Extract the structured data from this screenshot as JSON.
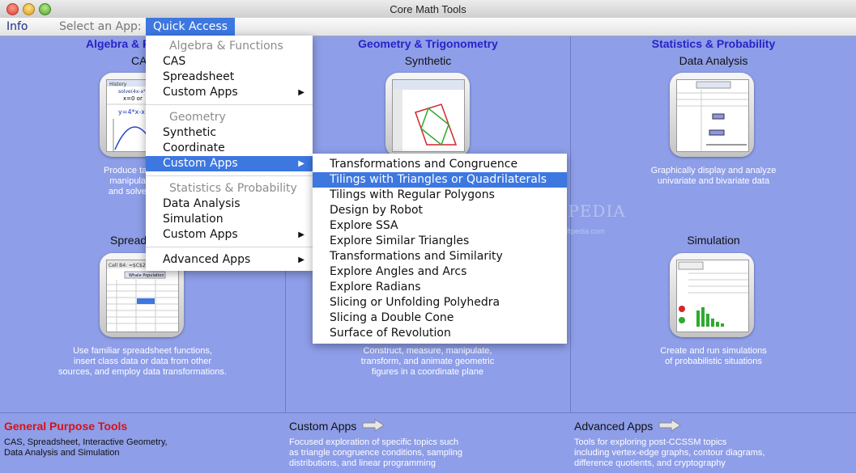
{
  "window": {
    "title": "Core Math Tools"
  },
  "menubar": {
    "info": "Info",
    "select_app": "Select an App:",
    "quick_access": "Quick Access"
  },
  "panels": {
    "algebra": {
      "category": "Algebra & F",
      "app1": "CAS",
      "desc1": [
        "Produce tables and g",
        "manipulate symbo",
        "and solve equation"
      ],
      "app2": "Spread",
      "desc2": [
        "Use familiar spreadsheet functions,",
        "insert class data or data from other",
        "sources, and employ data transformations."
      ]
    },
    "geometry": {
      "category": "Geometry & Trigonometry",
      "app1": "Synthetic",
      "desc2": [
        "Construct, measure, manipulate,",
        "transform, and animate geometric",
        "figures in a coordinate plane"
      ]
    },
    "statistics": {
      "category": "Statistics & Probability",
      "app1": "Data Analysis",
      "desc1": [
        "Graphically display and analyze",
        "univariate and bivariate data"
      ],
      "app2": "Simulation",
      "desc2": [
        "Create and run simulations",
        "of probabilistic situations"
      ]
    }
  },
  "bottom": {
    "general": {
      "title": "General Purpose Tools",
      "lines": [
        "CAS, Spreadsheet, Interactive Geometry,",
        "Data Analysis and Simulation"
      ]
    },
    "custom": {
      "title": "Custom Apps",
      "lines": [
        "Focused exploration of specific topics such",
        "as triangle congruence conditions, sampling",
        "distributions, and linear programming"
      ]
    },
    "advanced": {
      "title": "Advanced Apps",
      "lines": [
        "Tools for exploring post-CCSSM topics",
        "including vertex-edge graphs, contour diagrams,",
        "difference quotients, and cryptography"
      ]
    }
  },
  "quick_menu": {
    "h_algebra": "Algebra & Functions",
    "cas": "CAS",
    "spreadsheet": "Spreadsheet",
    "custom1": "Custom Apps",
    "h_geometry": "Geometry",
    "synthetic": "Synthetic",
    "coordinate": "Coordinate",
    "custom2": "Custom Apps",
    "h_stats": "Statistics & Probability",
    "data_analysis": "Data Analysis",
    "simulation": "Simulation",
    "custom3": "Custom Apps",
    "advanced": "Advanced Apps",
    "arrow": "▶"
  },
  "submenu": {
    "items": [
      "Transformations and Congruence",
      "Tilings with Triangles or Quadrilaterals",
      "Tilings with Regular Polygons",
      "Design by Robot",
      "Explore SSA",
      "Explore Similar Triangles",
      "Transformations and Similarity",
      "Explore Angles and Arcs",
      "Explore Radians",
      "Slicing or Unfolding Polyhedra",
      "Slicing a Double Cone",
      "Surface of Revolution"
    ],
    "selected_index": 1
  },
  "watermark": {
    "main": "SOFTPEDIA",
    "sub": "www.softpedia.com"
  },
  "icons": {
    "cas": "cas-app-icon",
    "spreadsheet": "spreadsheet-app-icon",
    "synthetic": "synthetic-geometry-icon",
    "data_analysis": "data-analysis-icon",
    "simulation": "simulation-icon",
    "arrow": "right-arrow-icon"
  },
  "colors": {
    "background": "#8e9ee8",
    "category": "#2a22c8",
    "highlight": "#3d77e0",
    "general_title": "#d4131b"
  }
}
